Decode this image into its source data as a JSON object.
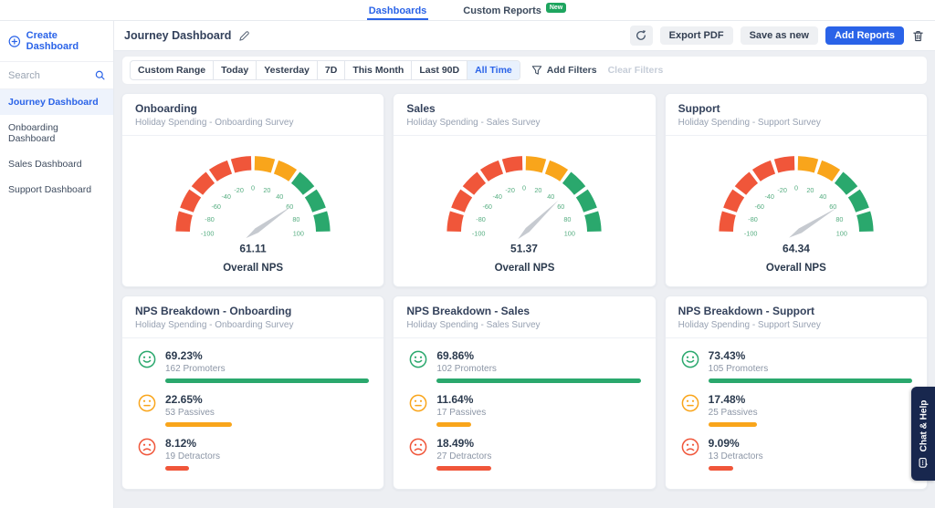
{
  "colors": {
    "accent": "#2a63e8",
    "promoters": "#2aa86d",
    "passives": "#f9a51b",
    "detractors": "#f0563a",
    "gauge_tick": "#55ad80",
    "needle": "#c6cad0",
    "badge_green": "#1ea55f",
    "chat_tab_bg": "#18274e"
  },
  "topnav": {
    "tabs": [
      {
        "label": "Dashboards",
        "active": true
      },
      {
        "label": "Custom Reports",
        "active": false,
        "badge": "New"
      }
    ]
  },
  "sidebar": {
    "create_label": "Create Dashboard",
    "search_placeholder": "Search",
    "items": [
      {
        "label": "Journey Dashboard",
        "active": true
      },
      {
        "label": "Onboarding Dashboard",
        "active": false
      },
      {
        "label": "Sales Dashboard",
        "active": false
      },
      {
        "label": "Support Dashboard",
        "active": false
      }
    ]
  },
  "header": {
    "title": "Journey Dashboard",
    "export_label": "Export PDF",
    "save_label": "Save as new",
    "add_label": "Add Reports"
  },
  "filters": {
    "options": [
      "Custom Range",
      "Today",
      "Yesterday",
      "7D",
      "This Month",
      "Last 90D",
      "All Time"
    ],
    "selected": "All Time",
    "add_label": "Add Filters",
    "clear_label": "Clear Filters"
  },
  "chat": {
    "label": "Chat & Help"
  },
  "chart_data": [
    {
      "type": "gauge",
      "title": "Onboarding",
      "subtitle": "Holiday Spending - Onboarding Survey",
      "value": 61.11,
      "value_label": "61.11",
      "center_label": "Overall NPS",
      "min": -100,
      "max": 100,
      "segment_step": 20,
      "ticks": [
        -100,
        -80,
        -60,
        -40,
        -20,
        0,
        20,
        40,
        60,
        80,
        100
      ],
      "zones": [
        {
          "from": -100,
          "to": 0,
          "color": "#f0563a"
        },
        {
          "from": 0,
          "to": 40,
          "color": "#f9a51b"
        },
        {
          "from": 40,
          "to": 100,
          "color": "#2aa86d"
        }
      ]
    },
    {
      "type": "gauge",
      "title": "Sales",
      "subtitle": "Holiday Spending - Sales Survey",
      "value": 51.37,
      "value_label": "51.37",
      "center_label": "Overall NPS",
      "min": -100,
      "max": 100,
      "segment_step": 20,
      "ticks": [
        -100,
        -80,
        -60,
        -40,
        -20,
        0,
        20,
        40,
        60,
        80,
        100
      ],
      "zones": [
        {
          "from": -100,
          "to": 0,
          "color": "#f0563a"
        },
        {
          "from": 0,
          "to": 40,
          "color": "#f9a51b"
        },
        {
          "from": 40,
          "to": 100,
          "color": "#2aa86d"
        }
      ]
    },
    {
      "type": "gauge",
      "title": "Support",
      "subtitle": "Holiday Spending - Support Survey",
      "value": 64.34,
      "value_label": "64.34",
      "center_label": "Overall NPS",
      "min": -100,
      "max": 100,
      "segment_step": 20,
      "ticks": [
        -100,
        -80,
        -60,
        -40,
        -20,
        0,
        20,
        40,
        60,
        80,
        100
      ],
      "zones": [
        {
          "from": -100,
          "to": 0,
          "color": "#f0563a"
        },
        {
          "from": 0,
          "to": 40,
          "color": "#f9a51b"
        },
        {
          "from": 40,
          "to": 100,
          "color": "#2aa86d"
        }
      ]
    },
    {
      "type": "bar",
      "title": "NPS Breakdown - Onboarding",
      "subtitle": "Holiday Spending - Onboarding Survey",
      "rows": [
        {
          "kind": "promoters",
          "pct": 69.23,
          "pct_label": "69.23%",
          "count_label": "162 Promoters"
        },
        {
          "kind": "passives",
          "pct": 22.65,
          "pct_label": "22.65%",
          "count_label": "53 Passives"
        },
        {
          "kind": "detractors",
          "pct": 8.12,
          "pct_label": "8.12%",
          "count_label": "19 Detractors"
        }
      ]
    },
    {
      "type": "bar",
      "title": "NPS Breakdown - Sales",
      "subtitle": "Holiday Spending - Sales Survey",
      "rows": [
        {
          "kind": "promoters",
          "pct": 69.86,
          "pct_label": "69.86%",
          "count_label": "102 Promoters"
        },
        {
          "kind": "passives",
          "pct": 11.64,
          "pct_label": "11.64%",
          "count_label": "17 Passives"
        },
        {
          "kind": "detractors",
          "pct": 18.49,
          "pct_label": "18.49%",
          "count_label": "27 Detractors"
        }
      ]
    },
    {
      "type": "bar",
      "title": "NPS Breakdown - Support",
      "subtitle": "Holiday Spending - Support Survey",
      "rows": [
        {
          "kind": "promoters",
          "pct": 73.43,
          "pct_label": "73.43%",
          "count_label": "105 Promoters"
        },
        {
          "kind": "passives",
          "pct": 17.48,
          "pct_label": "17.48%",
          "count_label": "25 Passives"
        },
        {
          "kind": "detractors",
          "pct": 9.09,
          "pct_label": "9.09%",
          "count_label": "13 Detractors"
        }
      ]
    }
  ]
}
